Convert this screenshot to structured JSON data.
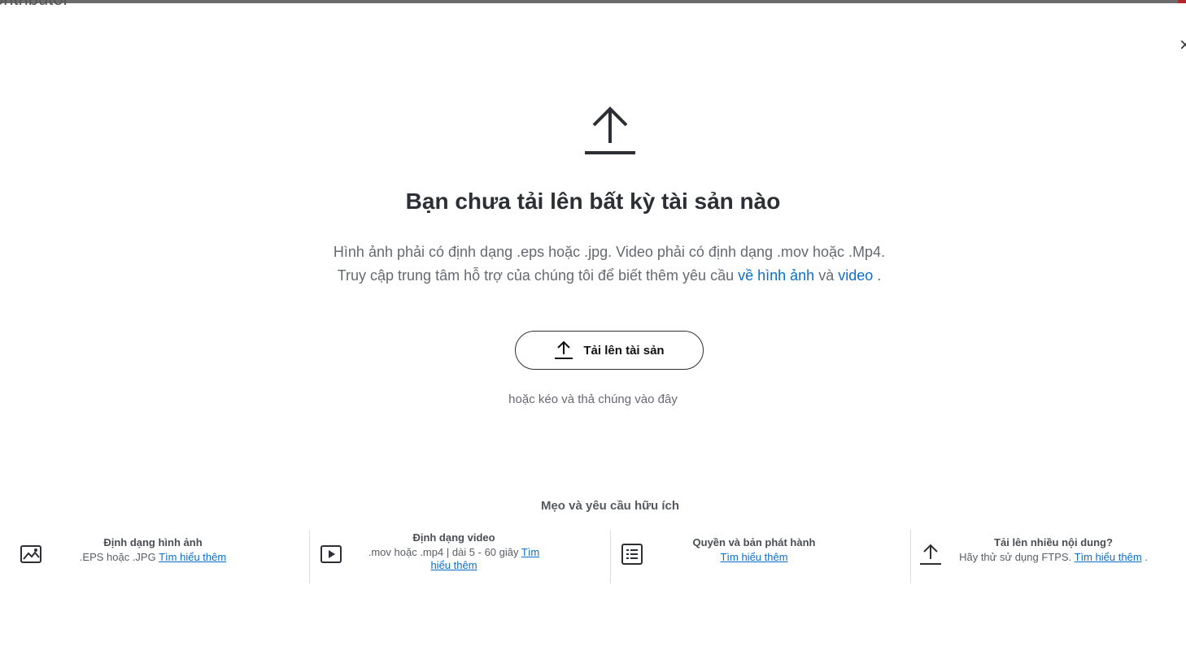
{
  "background_text": "ontributor",
  "close_label": "×",
  "hero": {
    "title": "Bạn chưa tải lên bất kỳ tài sản nào",
    "desc_part1": "Hình ảnh phải có định dạng .eps hoặc .jpg. Video phải có định dạng .mov hoặc .Mp4. Truy cập trung tâm hỗ trợ của chúng tôi để biết thêm yêu cầu",
    "link_images": "về hình ảnh",
    "desc_and": "và",
    "link_video": "video",
    "desc_end": ".",
    "upload_button": "Tải lên tài sản",
    "drag_hint": "hoặc kéo và thả chúng vào đây"
  },
  "tips": {
    "title": "Mẹo và yêu cầu hữu ích",
    "items": [
      {
        "icon": "image-icon",
        "title": "Định dạng hình ảnh",
        "text": ".EPS hoặc .JPG",
        "link": "Tìm hiểu thêm",
        "suffix": ""
      },
      {
        "icon": "play-icon",
        "title": "Định dạng video",
        "text": ".mov hoặc .mp4 | dài 5 - 60 giây",
        "link": "Tìm hiểu thêm",
        "suffix": ""
      },
      {
        "icon": "list-icon",
        "title": "Quyền và bản phát hành",
        "text": "",
        "link": "Tìm hiểu thêm",
        "suffix": ""
      },
      {
        "icon": "upload-icon",
        "title": "Tải lên nhiều nội dung?",
        "text": "Hãy thử sử dụng FTPS.",
        "link": "Tìm hiểu thêm",
        "suffix": "."
      }
    ]
  },
  "colors": {
    "link": "#0a6ed1",
    "text_dark": "#2c2f33",
    "text_muted": "#666a70",
    "accent": "#b3262e"
  }
}
